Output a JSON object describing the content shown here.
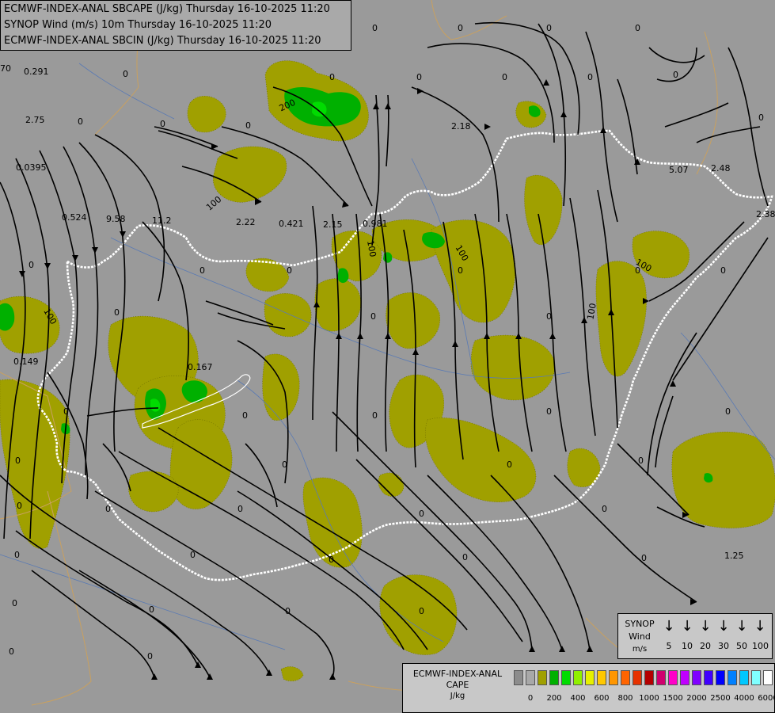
{
  "titles": {
    "line1": "ECMWF-INDEX-ANAL SBCAPE (J/kg) Thursday 16-10-2025 11:20",
    "line2": "SYNOP Wind (m/s) 10m Thursday 16-10-2025 11:20",
    "line3": "ECMWF-INDEX-ANAL SBCIN (J/kg) Thursday 16-10-2025 11:20"
  },
  "wind_legend": {
    "title_line1": "SYNOP",
    "title_line2": "Wind",
    "title_line3": "m/s",
    "items": [
      {
        "arrow": "↓",
        "value": "5"
      },
      {
        "arrow": "↓",
        "value": "10"
      },
      {
        "arrow": "↓",
        "value": "20"
      },
      {
        "arrow": "↓",
        "value": "30"
      },
      {
        "arrow": "↓",
        "value": "50"
      },
      {
        "arrow": "↓",
        "value": "100"
      }
    ]
  },
  "cape_legend": {
    "title_line1": "ECMWF-INDEX-ANAL",
    "title_line2": "CAPE",
    "title_line3": "J/kg",
    "colors": [
      "#8c8c8c",
      "#a8a8a8",
      "#a0a000",
      "#00b000",
      "#00dc00",
      "#90f000",
      "#e6f000",
      "#ffc800",
      "#ff9600",
      "#ff6400",
      "#e63200",
      "#b40000",
      "#d0006e",
      "#ff00c8",
      "#c000ff",
      "#8000ff",
      "#4000ff",
      "#0000ff",
      "#0080ff",
      "#00c8ff",
      "#80ffff",
      "#ffffff"
    ],
    "ticks": [
      "0",
      "200",
      "400",
      "600",
      "800",
      "1000",
      "1500",
      "2000",
      "2500",
      "4000",
      "6000"
    ]
  },
  "map_labels": [
    {
      "text": "0.291"
    },
    {
      "text": "2.75"
    },
    {
      "text": "0.0395"
    },
    {
      "text": "0.524"
    },
    {
      "text": "9.58"
    },
    {
      "text": "11.2"
    },
    {
      "text": "2.22"
    },
    {
      "text": "0.421"
    },
    {
      "text": "2.15"
    },
    {
      "text": "0.981"
    },
    {
      "text": "2.18"
    },
    {
      "text": "5.07"
    },
    {
      "text": "2.48"
    },
    {
      "text": "2.38"
    },
    {
      "text": "0.149"
    },
    {
      "text": "0.167"
    },
    {
      "text": "1.25"
    },
    {
      "text": "200"
    },
    {
      "text": "100"
    },
    {
      "text": "100"
    },
    {
      "text": "100"
    },
    {
      "text": "100"
    },
    {
      "text": "100"
    },
    {
      "text": "100"
    },
    {
      "text": "0"
    },
    {
      "text": "0"
    },
    {
      "text": "0"
    },
    {
      "text": "0"
    },
    {
      "text": "0"
    },
    {
      "text": "0"
    },
    {
      "text": "0"
    },
    {
      "text": "0"
    },
    {
      "text": "0"
    },
    {
      "text": "0"
    },
    {
      "text": "0"
    },
    {
      "text": "0"
    },
    {
      "text": "0"
    },
    {
      "text": "0"
    },
    {
      "text": "0"
    },
    {
      "text": "0"
    },
    {
      "text": "0"
    },
    {
      "text": "0"
    },
    {
      "text": "0"
    },
    {
      "text": "0"
    },
    {
      "text": "0"
    },
    {
      "text": "0"
    },
    {
      "text": "0"
    },
    {
      "text": "0"
    },
    {
      "text": "0"
    },
    {
      "text": "0"
    },
    {
      "text": "0"
    },
    {
      "text": "0"
    },
    {
      "text": "0"
    },
    {
      "text": "0"
    },
    {
      "text": "0"
    },
    {
      "text": "0"
    },
    {
      "text": "0"
    },
    {
      "text": "0"
    },
    {
      "text": "0"
    },
    {
      "text": "0"
    },
    {
      "text": "0"
    },
    {
      "text": "0"
    },
    {
      "text": "0"
    },
    {
      "text": "0"
    },
    {
      "text": "0"
    },
    {
      "text": "0"
    },
    {
      "text": "0"
    },
    {
      "text": "0"
    },
    {
      "text": "0"
    },
    {
      "text": "0"
    },
    {
      "text": "0"
    },
    {
      "text": "0"
    },
    {
      "text": "70"
    }
  ],
  "colors": {
    "background": "#9a9a9a",
    "cape_low": "#a0a000",
    "cape_mid": "#00b000",
    "cape_high": "#00dc00",
    "border": "#ffffff",
    "streamline": "#000000",
    "river": "#5a7ab4"
  }
}
